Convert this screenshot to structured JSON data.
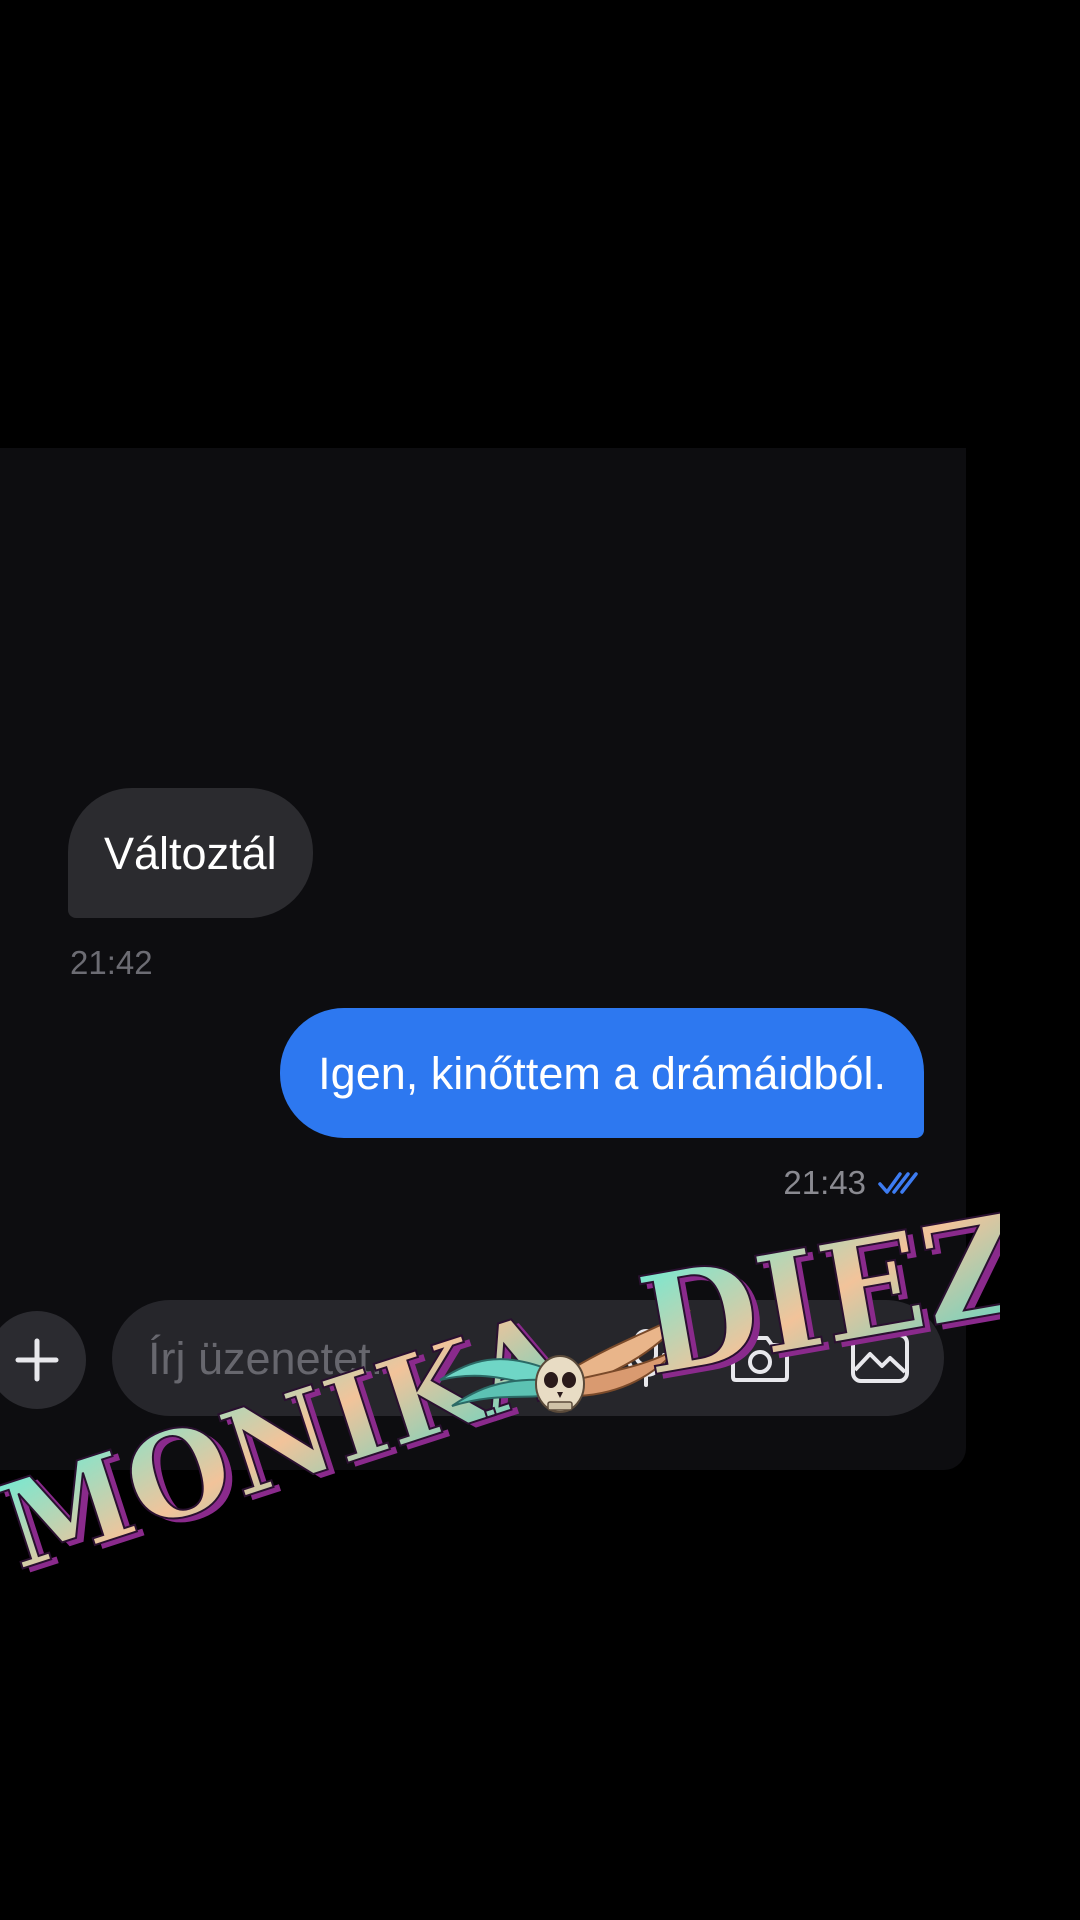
{
  "conversation": {
    "messages": [
      {
        "direction": "incoming",
        "text": "Változtál",
        "time": "21:42"
      },
      {
        "direction": "outgoing",
        "text": "Igen, kinőttem a drámáidból.",
        "time": "21:43",
        "status_icon": "double-check-icon"
      }
    ]
  },
  "composer": {
    "placeholder": "Írj üzenetet...",
    "buttons": [
      "plus-icon",
      "microphone-icon",
      "camera-icon",
      "image-icon"
    ]
  },
  "watermark": {
    "text_left": "MONIKA",
    "text_right": "DIEZ",
    "emblem": "winged-skull-icon"
  },
  "colors": {
    "background": "#000000",
    "chat_background": "#0d0d10",
    "incoming_bubble": "#2b2b2f",
    "outgoing_bubble": "#2d78f0",
    "read_check": "#3d7cf2",
    "input_bar": "#26262b",
    "watermark_fill": "#4fe3d0",
    "watermark_shadow": "#b23fb0"
  }
}
